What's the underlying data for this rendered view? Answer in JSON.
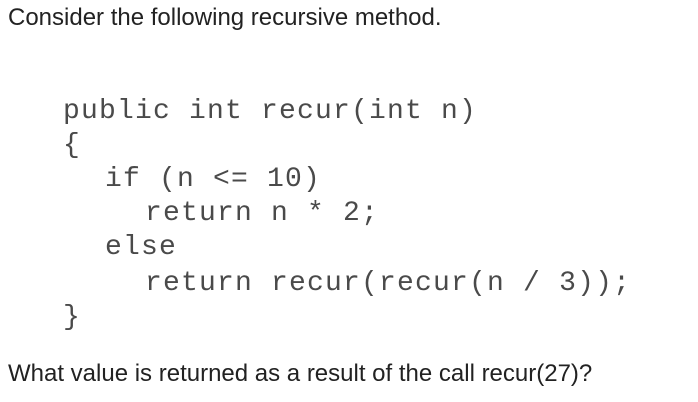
{
  "prompt": "Consider the following recursive method.",
  "code": {
    "line1": "public int recur(int n)",
    "line2": "{",
    "line3": "if (n <= 10)",
    "line4": "return n * 2;",
    "line5": "else",
    "line6": "return recur(recur(n / 3));",
    "line7": "}"
  },
  "question": "What value is returned as a result of the call recur(27)?"
}
